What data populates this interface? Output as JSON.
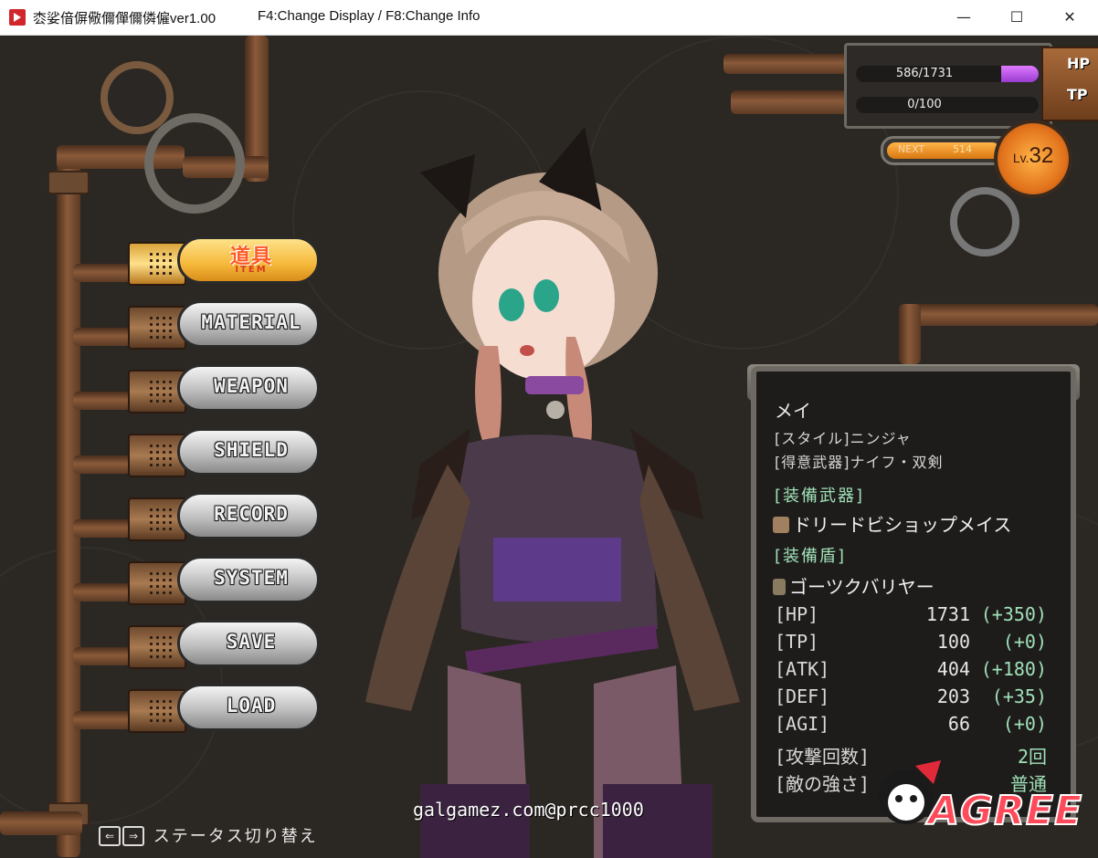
{
  "window": {
    "title": "枩娑偣偋儆儞僤儞僯僱ver1.00",
    "keys_hint": "F4:Change Display / F8:Change Info",
    "minimize_glyph": "—",
    "maximize_glyph": "☐",
    "close_glyph": "✕"
  },
  "menu": {
    "items": [
      {
        "label": "道具",
        "sub": "ITEM",
        "active": true
      },
      {
        "label": "MATERIAL"
      },
      {
        "label": "WEAPON"
      },
      {
        "label": "SHIELD"
      },
      {
        "label": "RECORD"
      },
      {
        "label": "SYSTEM"
      },
      {
        "label": "SAVE"
      },
      {
        "label": "LOAD"
      }
    ]
  },
  "gauges": {
    "hp_text": "586/1731",
    "hp_fraction": 0.338,
    "tp_text": "0/100",
    "tp_fraction": 0.0,
    "hp_label": "HP",
    "tp_label": "TP",
    "next_label": "NEXT",
    "next_value": "514",
    "level_prefix": "Lv.",
    "level": "32"
  },
  "status": {
    "name": "メイ",
    "style": "[スタイル]ニンジャ",
    "weapon_type": "[得意武器]ナイフ・双剣",
    "equip_weapon_head": "[装備武器]",
    "equip_weapon": "ドリードビショップメイス",
    "equip_shield_head": "[装備盾]",
    "equip_shield": "ゴーツクバリヤー",
    "stats": [
      {
        "key": "[HP]",
        "value": "1731",
        "bonus": "(+350)"
      },
      {
        "key": "[TP]",
        "value": "100",
        "bonus": "(+0)"
      },
      {
        "key": "[ATK]",
        "value": "404",
        "bonus": "(+180)"
      },
      {
        "key": "[DEF]",
        "value": "203",
        "bonus": "(+35)"
      },
      {
        "key": "[AGI]",
        "value": "66",
        "bonus": "(+0)"
      },
      {
        "key": "[攻撃回数]",
        "value": "2回",
        "bonus": ""
      },
      {
        "key": "[敵の強さ]",
        "value": "普通",
        "bonus": ""
      }
    ]
  },
  "footer": {
    "hint": "ステータス切り替え",
    "key_left": "⇐",
    "key_right": "⇒",
    "watermark": "galgamez.com@prcc1000",
    "logo": "AGREE"
  },
  "colors": {
    "accent_hp": "#c15cf0",
    "accent_level": "#f0901e",
    "menu_active": "#f5b83a",
    "menu_active_text": "#ff5a22"
  }
}
